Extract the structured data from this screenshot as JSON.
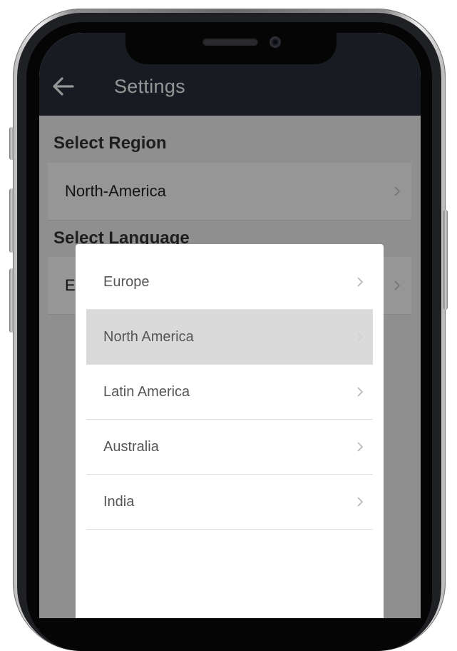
{
  "app_bar": {
    "title": "Settings",
    "back_icon": "arrow-left-icon"
  },
  "sections": {
    "region": {
      "title": "Select Region",
      "value": "North-America"
    },
    "language": {
      "title": "Select Language",
      "value": "E"
    }
  },
  "region_dialog": {
    "selected": "North America",
    "items": [
      {
        "label": "Europe",
        "icon": "chevron-right-icon"
      },
      {
        "label": "North America",
        "icon": "chevron-right-icon"
      },
      {
        "label": "Latin America",
        "icon": "chevron-right-icon"
      },
      {
        "label": "Australia",
        "icon": "chevron-right-icon"
      },
      {
        "label": "India",
        "icon": "chevron-right-icon"
      }
    ]
  },
  "colors": {
    "app_bar": "#292e3b",
    "selected_item": "#dadada",
    "scrim": "rgba(0,0,0,0.41)"
  }
}
